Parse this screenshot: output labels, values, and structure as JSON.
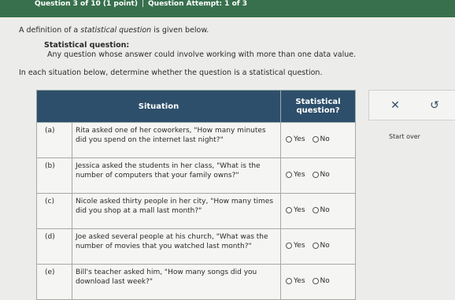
{
  "header": {
    "question_info": "Question 3 of 10 (1 point)",
    "separator": "|",
    "attempt": "Question Attempt: 1 of 3"
  },
  "prompt": {
    "before": "A definition of a ",
    "italic": "statistical question",
    "after": " is given below."
  },
  "definition": {
    "term": "Statistical question:",
    "description": "Any question whose answer could involve working with more than one data value."
  },
  "instruction": "In each situation below, determine whether the question is a statistical question.",
  "table": {
    "col_situation": "Situation",
    "col_statistical": "Statistical question?",
    "rows": [
      {
        "label": "(a)",
        "text": "Rita asked one of her coworkers, \"How many minutes did you spend on the internet last night?\"",
        "yes": "Yes",
        "no": "No"
      },
      {
        "label": "(b)",
        "text": "Jessica asked the students in her class, \"What is the number of computers that your family owns?\"",
        "yes": "Yes",
        "no": "No"
      },
      {
        "label": "(c)",
        "text": "Nicole asked thirty people in her city, \"How many times did you shop at a mall last month?\"",
        "yes": "Yes",
        "no": "No"
      },
      {
        "label": "(d)",
        "text": "Joe asked several people at his church, \"What was the number of movies that you watched last month?\"",
        "yes": "Yes",
        "no": "No"
      },
      {
        "label": "(e)",
        "text": "Bill's teacher asked him, \"How many songs did you download last week?\"",
        "yes": "Yes",
        "no": "No"
      }
    ]
  },
  "tools": {
    "clear_glyph": "✕",
    "undo_glyph": "↺",
    "start_over": "Start over"
  },
  "colors": {
    "header_bar": "#38704d",
    "table_header": "#2e4f6b"
  }
}
